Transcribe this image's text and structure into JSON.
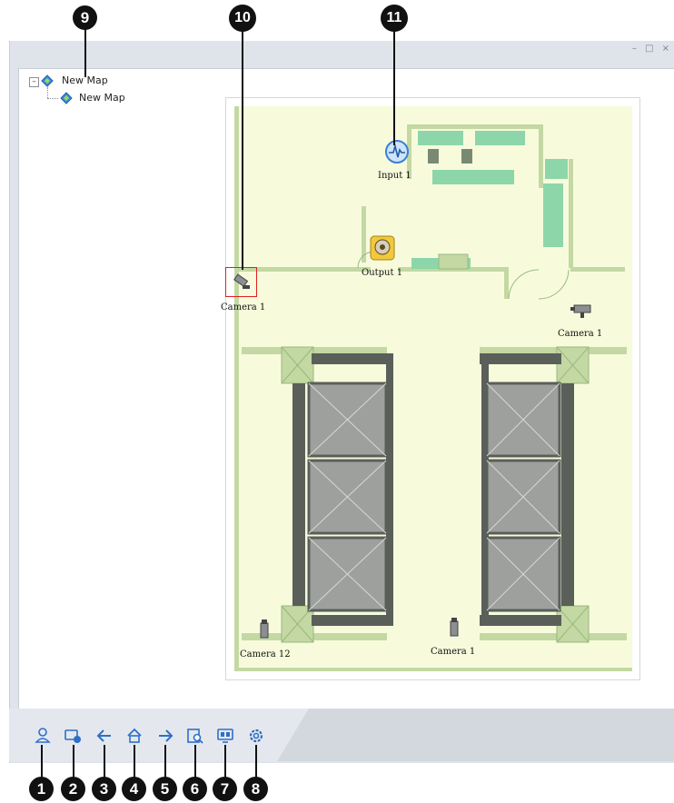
{
  "window": {
    "controls": "– □ ×"
  },
  "tree": {
    "root_label": "New Map",
    "child_label": "New Map"
  },
  "map": {
    "labels": {
      "input": "Input 1",
      "output": "Output 1",
      "camera_selected": "Camera 1",
      "camera_right": "Camera 1",
      "camera_bottom_left": "Camera 12",
      "camera_bottom_mid": "Camera 1"
    }
  },
  "toolbar": {
    "icons": [
      "user-icon",
      "device-info-icon",
      "back-arrow-icon",
      "home-icon",
      "forward-arrow-icon",
      "search-map-icon",
      "display-icon",
      "settings-gear-icon"
    ]
  },
  "callouts": [
    "1",
    "2",
    "3",
    "4",
    "5",
    "6",
    "7",
    "8",
    "9",
    "10",
    "11"
  ],
  "colors": {
    "floor": "#f7fbdc",
    "wall": "#c3d8a3",
    "furniture": "#8dd6a9",
    "selection": "#e02020",
    "toolbar_icon": "#2e6fc7"
  }
}
